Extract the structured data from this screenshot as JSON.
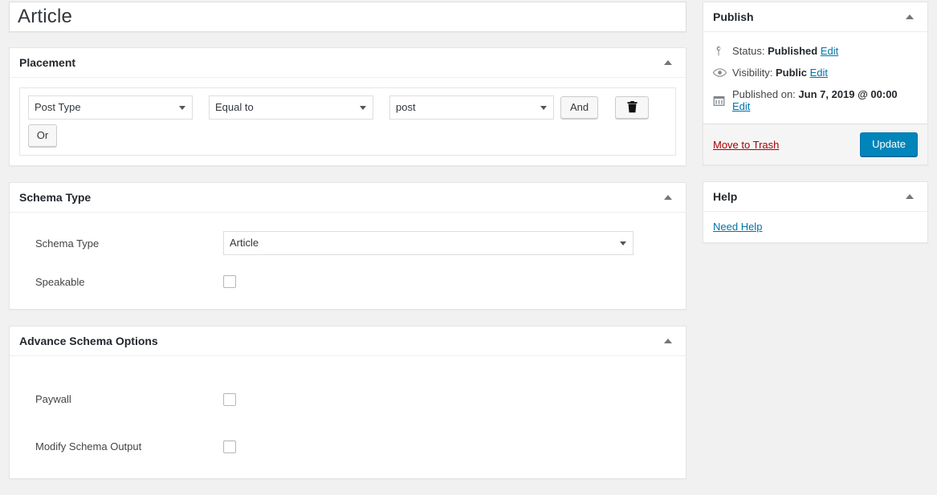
{
  "post_title": "Article",
  "placement": {
    "heading": "Placement",
    "toggle_icon": "collapse-triangle-icon",
    "rule": {
      "param": "Post Type",
      "operator": "Equal to",
      "value": "post"
    },
    "and_label": "And",
    "or_label": "Or",
    "delete_icon": "trash-icon"
  },
  "schema_type": {
    "heading": "Schema Type",
    "toggle_icon": "collapse-triangle-icon",
    "fields": {
      "schema_type_label": "Schema Type",
      "schema_type_value": "Article",
      "speakable_label": "Speakable",
      "speakable_checked": false
    }
  },
  "advance": {
    "heading": "Advance Schema Options",
    "toggle_icon": "collapse-triangle-icon",
    "fields": {
      "paywall_label": "Paywall",
      "paywall_checked": false,
      "modify_label": "Modify Schema Output",
      "modify_checked": false
    }
  },
  "publish": {
    "heading": "Publish",
    "toggle_icon": "collapse-triangle-icon",
    "status": {
      "icon": "post-status-pin-icon",
      "label": "Status:",
      "value": "Published",
      "edit": "Edit"
    },
    "visibility": {
      "icon": "eye-icon",
      "label": "Visibility:",
      "value": "Public",
      "edit": "Edit"
    },
    "published_on": {
      "icon": "calendar-icon",
      "label": "Published on:",
      "value": "Jun 7, 2019 @ 00:00",
      "edit": "Edit"
    },
    "trash_label": "Move to Trash",
    "update_label": "Update"
  },
  "help": {
    "heading": "Help",
    "toggle_icon": "collapse-triangle-icon",
    "link_label": "Need Help"
  },
  "colors": {
    "accent": "#0073aa",
    "primary_button": "#0085ba",
    "trash_link": "#a00",
    "page_background": "#f1f1f1",
    "panel_background": "#ffffff",
    "panel_border": "#e5e5e5"
  }
}
